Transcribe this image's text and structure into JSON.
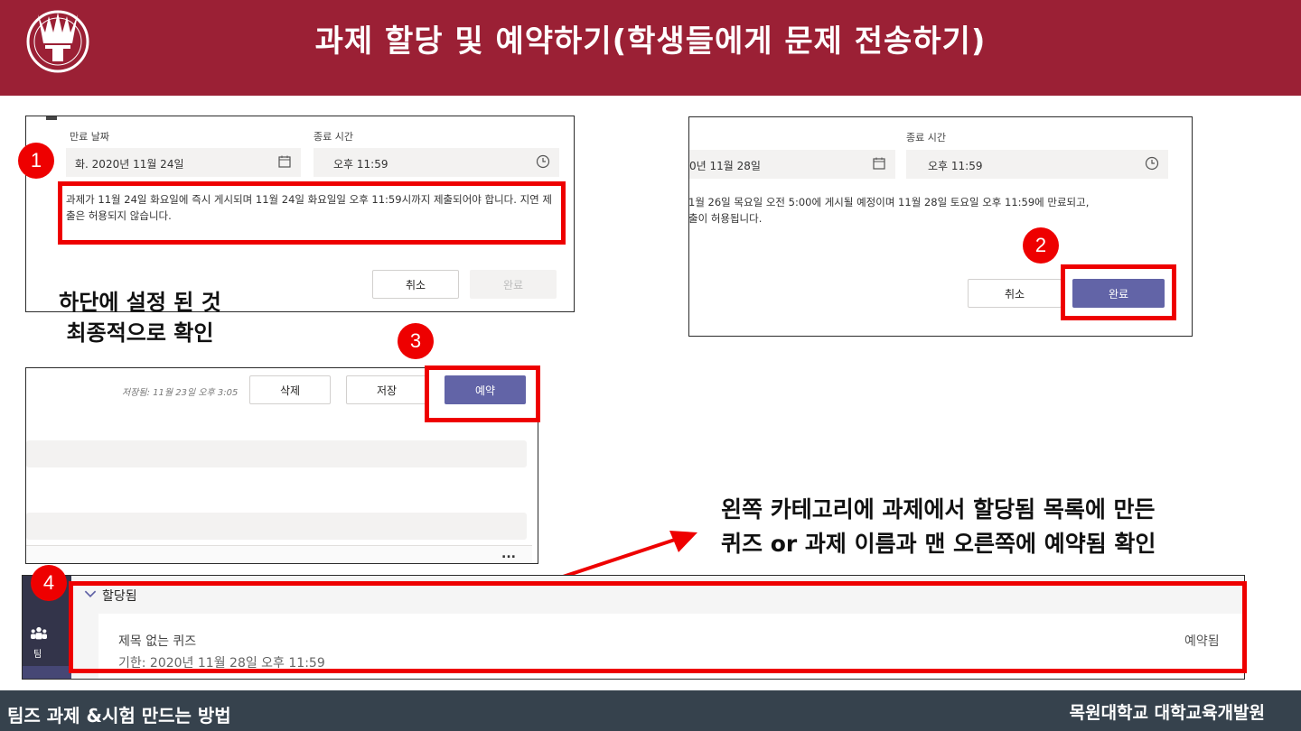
{
  "header": {
    "title": "과제 할당 및 예약하기(학생들에게 문제 전송하기)"
  },
  "footer": {
    "left": "팀즈 과제 &시험 만드는 방법",
    "right": "목원대학교 대학교육개발원"
  },
  "colors": {
    "header_bg": "#9b2035",
    "footer_bg": "#36424d",
    "teams_primary": "#6264a7",
    "highlight_red": "#ee0000"
  },
  "steps": [
    "1",
    "2",
    "3",
    "4"
  ],
  "panel1": {
    "due_date_label": "만료 날짜",
    "end_time_label": "종료 시간",
    "due_date_value": "화. 2020년 11월 24일",
    "end_time_value": "오후 11:59",
    "notice": "과제가 11월 24일 화요일에 즉시 게시되며 11월 24일 화요일일 오후 11:59시까지 제출되어야 합니다. 지연 제출은 허용되지 않습니다.",
    "cancel_label": "취소",
    "done_label": "완료"
  },
  "panel2": {
    "end_time_label": "종료 시간",
    "date_value": "0년 11월 28일",
    "time_value": "오후 11:59",
    "notice_line1": "1월 26일 목요일 오전 5:00에 게시될 예정이며 11월 28일 토요일 오후 11:59에 만료되고,",
    "notice_line2": "출이 허용됩니다.",
    "cancel_label": "취소",
    "done_label": "완료"
  },
  "caption_left": {
    "line1": "하단에 설정 된 것",
    "line2": "최종적으로 확인"
  },
  "panel3": {
    "saved_text": "저장됨: 11월 23일 오후 3:05",
    "delete_label": "삭제",
    "save_label": "저장",
    "schedule_label": "예약",
    "more": "..."
  },
  "caption_right": {
    "line1": "왼쪽 카테고리에 과제에서 할당됨 목록에 만든",
    "line2": "퀴즈 or 과제  이름과 맨 오른쪽에 예약됨 확인"
  },
  "panel4": {
    "section_label": "할당됨",
    "sidebar_team_label": "팀",
    "item_title": "제목 없는 퀴즈",
    "item_due": "기한: 2020년 11월 28일 오후 11:59",
    "item_status": "예약됨"
  }
}
